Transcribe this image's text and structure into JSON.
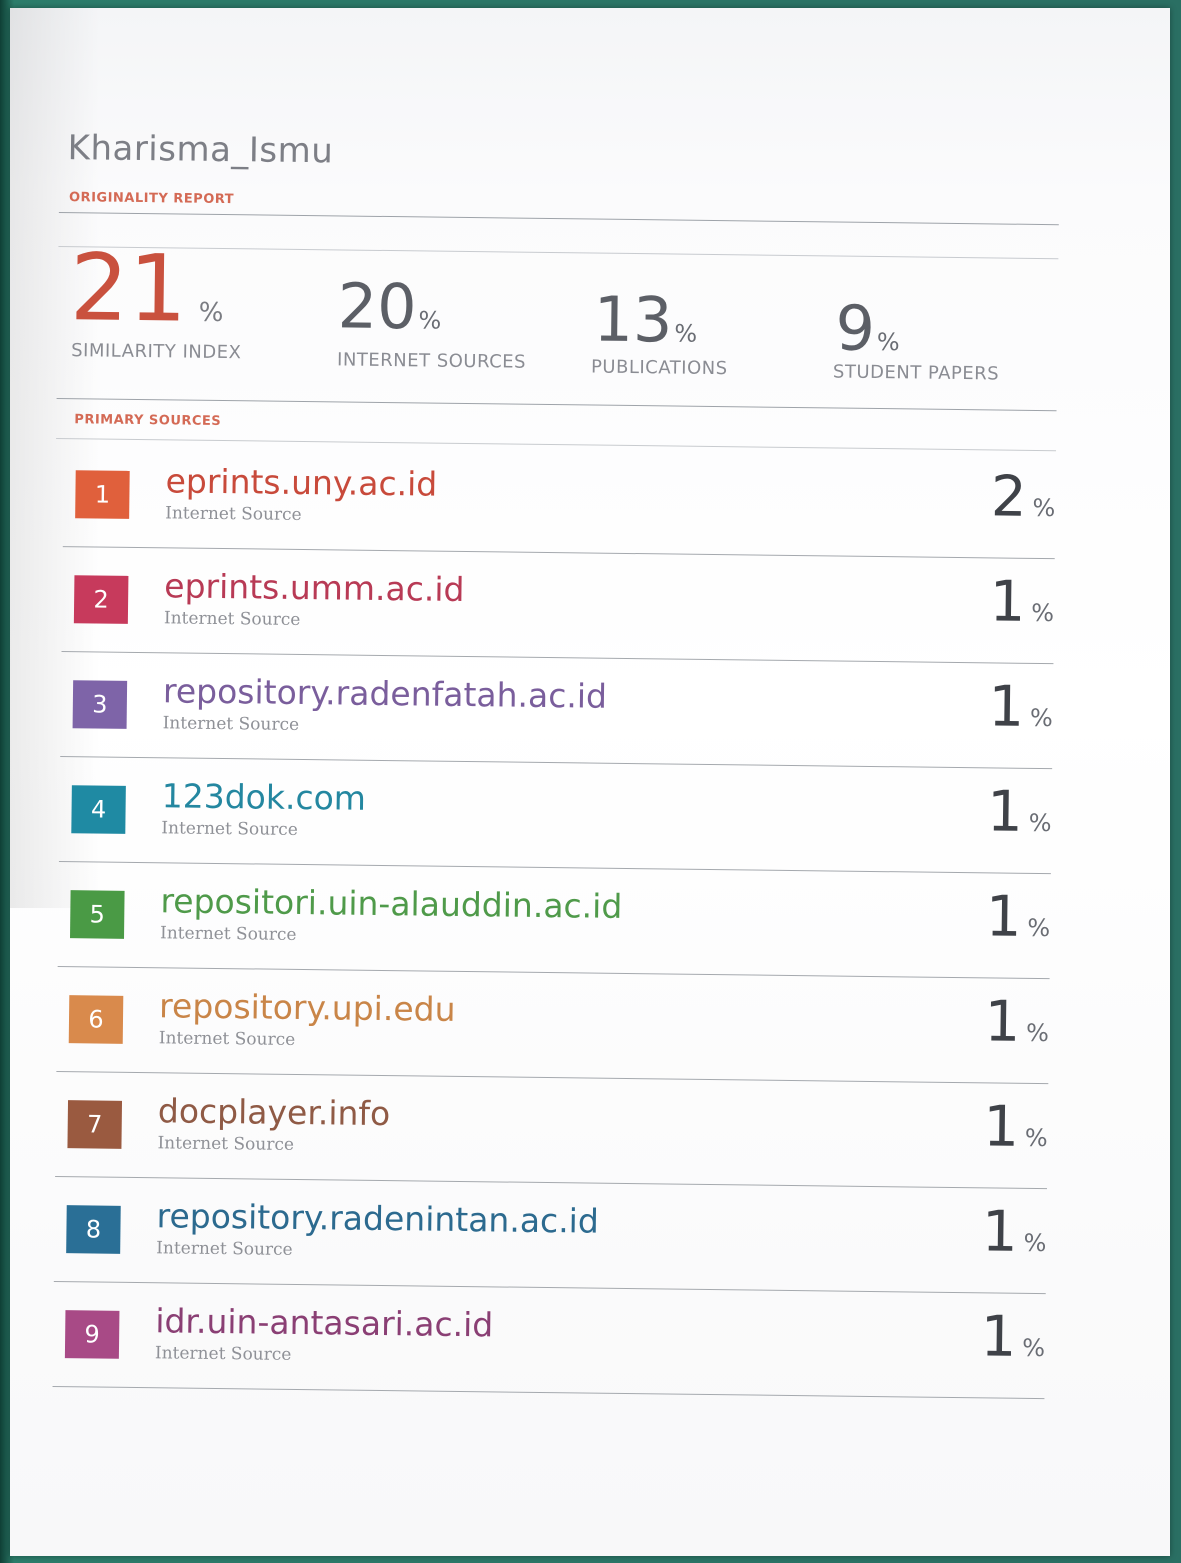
{
  "document": {
    "title": "Kharisma_Ismu",
    "report_label": "ORIGINALITY REPORT",
    "primary_sources_label": "PRIMARY SOURCES"
  },
  "summary": {
    "similarity_index": {
      "value": "21",
      "unit": "%",
      "label": "SIMILARITY INDEX"
    },
    "internet_sources": {
      "value": "20",
      "unit": "%",
      "label": "INTERNET SOURCES"
    },
    "publications": {
      "value": "13",
      "unit": "%",
      "label": "PUBLICATIONS"
    },
    "student_papers": {
      "value": "9",
      "unit": "%",
      "label": "STUDENT PAPERS"
    }
  },
  "sources": [
    {
      "rank": "1",
      "name": "eprints.uny.ac.id",
      "type": "Internet Source",
      "value": "2",
      "unit": "%",
      "badge_color": "#e0603c",
      "name_color": "#c84a3b"
    },
    {
      "rank": "2",
      "name": "eprints.umm.ac.id",
      "type": "Internet Source",
      "value": "1",
      "unit": "%",
      "badge_color": "#c73a5c",
      "name_color": "#b83a55"
    },
    {
      "rank": "3",
      "name": "repository.radenfatah.ac.id",
      "type": "Internet Source",
      "value": "1",
      "unit": "%",
      "badge_color": "#7e64a8",
      "name_color": "#7a5e9c"
    },
    {
      "rank": "4",
      "name": "123dok.com",
      "type": "Internet Source",
      "value": "1",
      "unit": "%",
      "badge_color": "#1f8aa3",
      "name_color": "#2487a0"
    },
    {
      "rank": "5",
      "name": "repositori.uin-alauddin.ac.id",
      "type": "Internet Source",
      "value": "1",
      "unit": "%",
      "badge_color": "#4a9a45",
      "name_color": "#4f9a4a"
    },
    {
      "rank": "6",
      "name": "repository.upi.edu",
      "type": "Internet Source",
      "value": "1",
      "unit": "%",
      "badge_color": "#d98a4c",
      "name_color": "#c98548"
    },
    {
      "rank": "7",
      "name": "docplayer.info",
      "type": "Internet Source",
      "value": "1",
      "unit": "%",
      "badge_color": "#9a5a40",
      "name_color": "#8f5a45"
    },
    {
      "rank": "8",
      "name": "repository.radenintan.ac.id",
      "type": "Internet Source",
      "value": "1",
      "unit": "%",
      "badge_color": "#2a6f96",
      "name_color": "#2c6a8f"
    },
    {
      "rank": "9",
      "name": "idr.uin-antasari.ac.id",
      "type": "Internet Source",
      "value": "1",
      "unit": "%",
      "badge_color": "#a84a86",
      "name_color": "#8a3f74"
    }
  ]
}
